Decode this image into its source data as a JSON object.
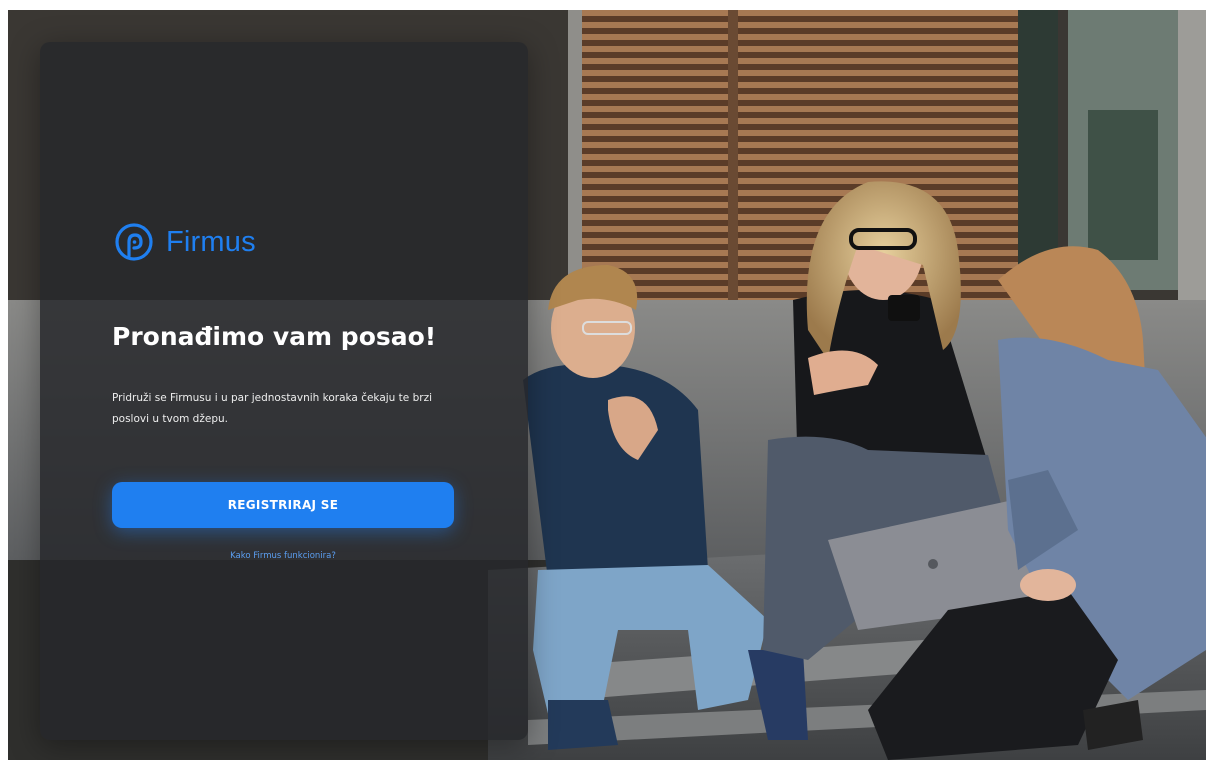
{
  "brand": {
    "name": "Firmus",
    "accent": "#1f7ff0"
  },
  "hero": {
    "headline": "Pronađimo vam posao!",
    "description": "Pridruži se Firmusu i u par jednostavnih koraka čekaju te brzi poslovi u tvom džepu."
  },
  "actions": {
    "register_label": "REGISTRIRAJ SE",
    "how_it_works_label": "Kako Firmus funkcionira?"
  },
  "icons": {
    "logo": "firmus-logo-icon"
  }
}
